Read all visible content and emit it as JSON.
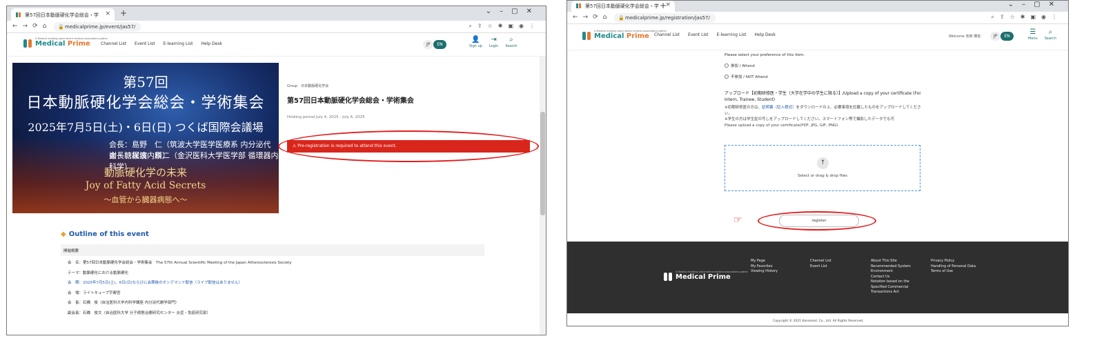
{
  "colors": {
    "brand": "#1e8a8a",
    "accent_orange": "#e8762c",
    "alert_red": "#d9261c",
    "annotation_red": "#e21d1d",
    "footer_bg": "#2f2f2f",
    "link_blue": "#1f5aa8"
  },
  "left": {
    "tab_title": "第57回日本動脈硬化学会総会・学",
    "url": "medicalprime.jp/event/jas57/",
    "logo": {
      "tagline": "A Medical meeting place where medical associations gather",
      "name_main": "Medical",
      "name_accent": "Prime"
    },
    "nav": [
      "Channel List",
      "Event List",
      "E-learning List",
      "Help Desk"
    ],
    "lang": {
      "jp": "JP",
      "en": "EN"
    },
    "header_icons": [
      {
        "label": "Sign up",
        "icon": "user-plus-icon"
      },
      {
        "label": "Login",
        "icon": "login-icon"
      },
      {
        "label": "Search",
        "icon": "search-icon"
      }
    ],
    "banner": {
      "line1": "第57回",
      "line2": "日本動脈硬化学会総会・学術集会",
      "line3": "2025年7月5日(土)・6日(日) つくば国際会議場",
      "role1": "会長：島野　仁（筑波大学医学医療系 内分泌代謝・糖尿病内科）",
      "role2": "会長：梶波　康二（金沢医科大学医学部 循環器内科学）",
      "theme_jp": "動脈硬化学の未来",
      "theme_en": "Joy of Fatty Acid Secrets",
      "sub": "～血管から臓器病態へ～"
    },
    "event": {
      "organizer": "Group　日本動脈硬化学会",
      "title": "第57回日本動脈硬化学会総会・学術集会",
      "period": "Holding period  July 4, 2025 - July 6, 2025"
    },
    "alert": "⚠ Pre-registration is required to attend this event.",
    "outline": {
      "heading": "Outline of this event",
      "bar": "開催概要",
      "rows": [
        "会　名：第57回日本動脈硬化学会総会・学術集会　The 57th Annual Scientific Meeting of the Japan Atherosclerosis Society",
        "テーマ：動脈硬化における動脈硬化",
        "会　期：2025年7月5日(土)、6日(日)ならびに会期後のオンデマンド配信（ライブ配信はありません）",
        "会　場：ライトキューブ宇都宮",
        "会　長：石橋　俊（自治医科大学内科学講座 内分泌代謝学部門）",
        "副会長：石橋　俊文（自治医科大学 分子病態治療研究センター 炎症・免疫研究部）"
      ]
    }
  },
  "right": {
    "tab_title": "第57回日本動脈硬化学会総会・学",
    "url": "medicalprime.jp/registration/jas57/",
    "nav": [
      "Channel List",
      "Event List",
      "E-learning List",
      "Help Desk"
    ],
    "welcome": "Welcome 池田 博道",
    "lang": {
      "jp": "JP",
      "en": "EN"
    },
    "header_icons": [
      {
        "label": "Menu",
        "icon": "menu-icon"
      },
      {
        "label": "Search",
        "icon": "search-icon"
      }
    ],
    "form": {
      "prompt": "Please select your preference of this item.",
      "options": [
        "参加 / Attend",
        "不参加 / NOT Attend"
      ],
      "upload_heading": "アップロード【初期研修医・学生（大学在学中の学生に限る）】/Upload a copy of your certificate (For Intern, Trainee, Student)",
      "note1_pre": "※初期研修医の方は、",
      "note1_link": "証明書（記入様式）",
      "note1_post": "をダウンロードの上、必要事項を記載したものをアップロードしてください。",
      "note2": "※学生の方は学生証の写しをアップロードしてください。スマートフォン等で撮影したデータでも可",
      "note3": "Please upload a copy of your certificate(PDF, JPG, GIF, PNG)",
      "dropzone_label": "Select or drag & drop files",
      "register_label": "register"
    },
    "footer": {
      "col1": [
        "My Page",
        "My Favorites",
        "Viewing History"
      ],
      "col2": [
        "Channel List",
        "Event List"
      ],
      "col3": [
        "About This Site",
        "Recommended System Environment",
        "Contact Us",
        "Notation based on the Specified Commercial Transactions Act"
      ],
      "col4": [
        "Privacy Policy",
        "Handling of Personal Data",
        "Terms of Use"
      ],
      "copyright": "Copyright © 2021 Kanamed. Co., Ltd. All Rights Reserved."
    }
  }
}
